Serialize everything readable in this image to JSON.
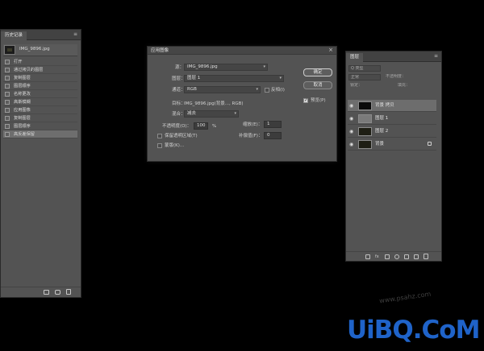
{
  "history_panel": {
    "tab_label": "历史记录",
    "menu_icon": "hamburger-menu-icon",
    "snapshot_label": "IMG_9896.jpg",
    "items": [
      {
        "label": "打开",
        "active": false
      },
      {
        "label": "通过拷贝的图层",
        "active": false
      },
      {
        "label": "复制图层",
        "active": false
      },
      {
        "label": "图层顺序",
        "active": false
      },
      {
        "label": "名称更改",
        "active": false
      },
      {
        "label": "高斯模糊",
        "active": false
      },
      {
        "label": "应用图像",
        "active": false
      },
      {
        "label": "复制图层",
        "active": false
      },
      {
        "label": "图层顺序",
        "active": false
      },
      {
        "label": "高反差保留",
        "active": true
      }
    ],
    "footer_icons": [
      "new-document-from-state-icon",
      "camera-snapshot-icon",
      "trash-icon"
    ]
  },
  "apply_image_dialog": {
    "title": "应用图像",
    "close_glyph": "×",
    "source_label": "源：",
    "source_value": "IMG_9896.jpg",
    "layer_label": "图层：",
    "layer_value": "图层 1",
    "channel_label": "通道：",
    "channel_value": "RGB",
    "invert_label": "反相(I)",
    "invert_checked": false,
    "target_label": "目标：",
    "target_value": "IMG_9896.jpg(背景..., RGB)",
    "blending_label": "混合：",
    "blending_value": "减去",
    "opacity_label": "不透明度(O)：",
    "opacity_value": "100",
    "opacity_unit": "%",
    "scale_label": "缩放(E)：",
    "scale_value": "1",
    "offset_label": "补偿值(F)：",
    "offset_value": "0",
    "preserve_label": "保留透明区域(T)",
    "preserve_checked": false,
    "mask_label": "蒙版(K)...",
    "mask_checked": false,
    "ok_label": "确定",
    "cancel_label": "取消",
    "preview_label": "预览(P)",
    "preview_checked": true
  },
  "layers_panel": {
    "tab_label": "图层",
    "menu_icon": "hamburger-menu-icon",
    "kind_filter": "Q 类型",
    "blend_mode": "正常",
    "opacity": "不透明度：",
    "lock": "锁定：",
    "fill": "填充：",
    "layers": [
      {
        "name": "背景 拷贝",
        "selected": true,
        "thumb_color": "#0a0a0a",
        "locked": false
      },
      {
        "name": "图层 1",
        "selected": false,
        "thumb_color": "#7a7a7a",
        "locked": false
      },
      {
        "name": "图层 2",
        "selected": false,
        "thumb_color": "#1e1e14",
        "locked": false
      },
      {
        "name": "背景",
        "selected": false,
        "thumb_color": "#1e1e14",
        "locked": true
      }
    ],
    "footer_icons": [
      "link-icon",
      "fx-icon",
      "mask-icon",
      "adjustment-icon",
      "group-folder-icon",
      "new-layer-icon",
      "trash-icon"
    ]
  },
  "watermark": {
    "small": "www.psahz.com",
    "big": "UiBQ.CoM"
  }
}
